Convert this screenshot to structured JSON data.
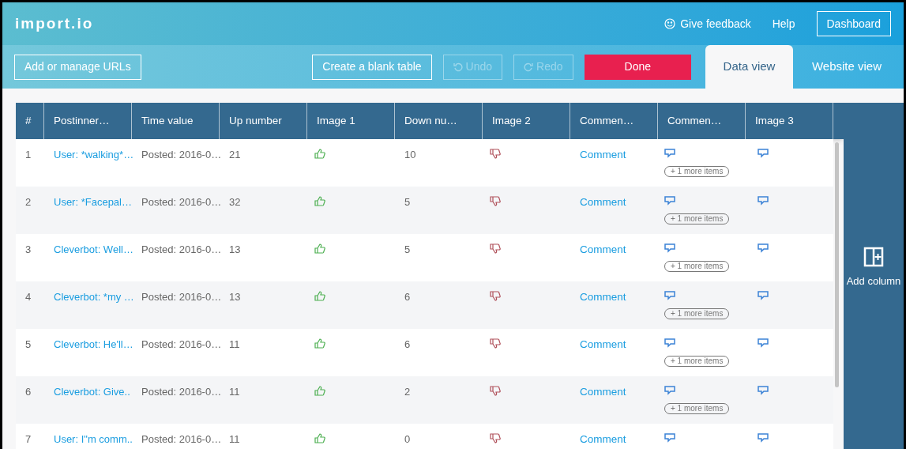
{
  "header": {
    "logo": "import.io",
    "feedback": "Give feedback",
    "help": "Help",
    "dashboard": "Dashboard"
  },
  "toolbar": {
    "buttons": [
      {
        "kind": "outline",
        "label": "Add or manage URLs",
        "disabled": false
      },
      {
        "kind": "spacer"
      },
      {
        "kind": "outline",
        "label": "Create a blank table",
        "disabled": false
      },
      {
        "kind": "undo",
        "label": "Undo",
        "disabled": true
      },
      {
        "kind": "redo",
        "label": "Redo",
        "disabled": true
      },
      {
        "kind": "primary",
        "label": "Done",
        "disabled": false
      }
    ],
    "tabs": [
      {
        "label": "Data view",
        "selected": true
      },
      {
        "label": "Website view",
        "selected": false
      }
    ]
  },
  "table": {
    "columns": [
      "#",
      "Postinner…",
      "Time value",
      "Up number",
      "Image 1",
      "Down nu…",
      "Image 2",
      "Commen…",
      "Commen…",
      "Image 3"
    ],
    "rows": [
      {
        "num": "1",
        "post": "User: *walking*…",
        "time": "Posted: 2016-0…",
        "up": "21",
        "down": "10",
        "comment": "Comment",
        "more": "+ 1 more items"
      },
      {
        "num": "2",
        "post": "User: *Facepal…",
        "time": "Posted: 2016-0…",
        "up": "32",
        "down": "5",
        "comment": "Comment",
        "more": "+ 1 more items"
      },
      {
        "num": "3",
        "post": "Cleverbot: Well…",
        "time": "Posted: 2016-0…",
        "up": "13",
        "down": "5",
        "comment": "Comment",
        "more": "+ 1 more items"
      },
      {
        "num": "4",
        "post": "Cleverbot: *my …",
        "time": "Posted: 2016-0…",
        "up": "13",
        "down": "6",
        "comment": "Comment",
        "more": "+ 1 more items"
      },
      {
        "num": "5",
        "post": "Cleverbot: He'll…",
        "time": "Posted: 2016-0…",
        "up": "11",
        "down": "6",
        "comment": "Comment",
        "more": "+ 1 more items"
      },
      {
        "num": "6",
        "post": "Cleverbot: Give..",
        "time": "Posted: 2016-0…",
        "up": "11",
        "down": "2",
        "comment": "Comment",
        "more": "+ 1 more items"
      },
      {
        "num": "7",
        "post": "User: I\"m comm..",
        "time": "Posted: 2016-0…",
        "up": "11",
        "down": "0",
        "comment": "Comment",
        "more": ""
      }
    ]
  },
  "add_column": "Add column"
}
